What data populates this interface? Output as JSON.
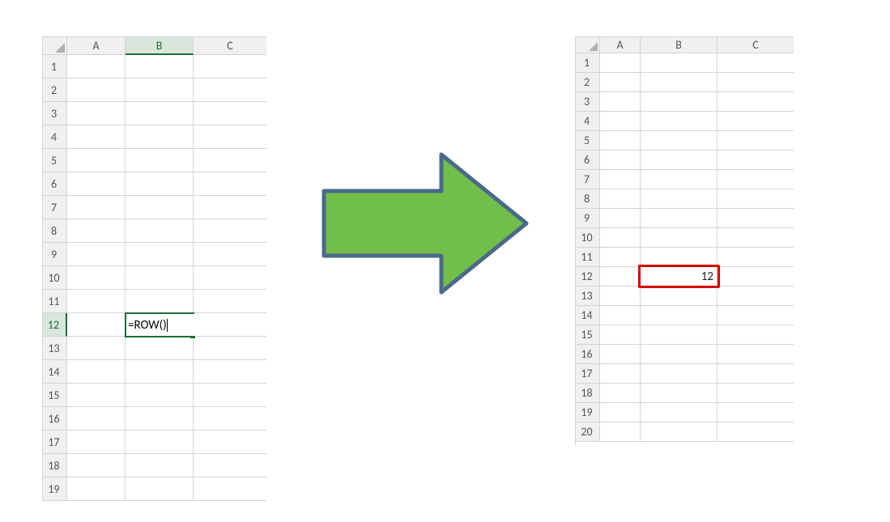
{
  "left_sheet": {
    "columns": [
      "A",
      "B",
      "C"
    ],
    "row_count": 19,
    "active_column_index": 1,
    "active_row": 12,
    "editing_cell": {
      "row": 12,
      "col": 1,
      "formula": "=ROW()"
    }
  },
  "right_sheet": {
    "columns": [
      "A",
      "B",
      "C"
    ],
    "row_count": 20,
    "highlighted_cell": {
      "row": 12,
      "col": 1,
      "value": "12"
    }
  },
  "arrow": {
    "fill": "#72be4a",
    "stroke": "#4a6a8a"
  }
}
